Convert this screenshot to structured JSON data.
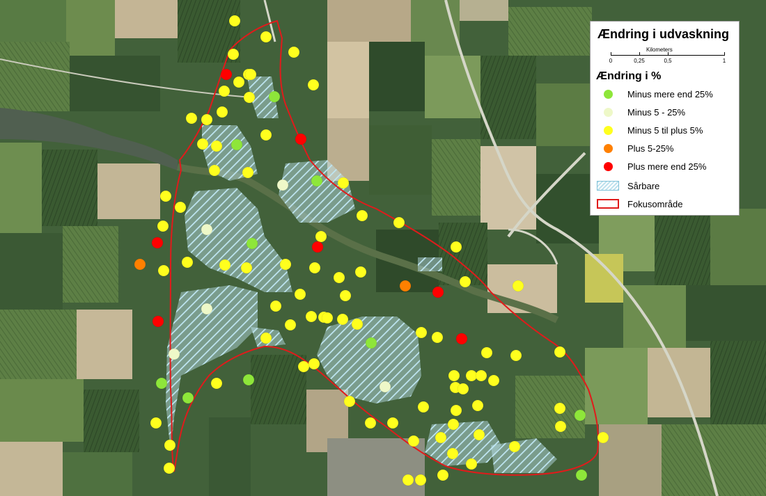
{
  "legend": {
    "title": "Ændring i udvaskning",
    "scale": {
      "caption": "Kilometers",
      "ticks": [
        "0",
        "0,25",
        "0,5",
        "1"
      ]
    },
    "subtitle": "Ændring i %",
    "items": [
      {
        "label": "Minus mere end 25%",
        "color": "#8ee63a",
        "kind": "dot"
      },
      {
        "label": "Minus 5 - 25%",
        "color": "#eef8c8",
        "kind": "dot"
      },
      {
        "label": "Minus 5 til plus 5%",
        "color": "#ffff1e",
        "kind": "dot"
      },
      {
        "label": "Plus 5-25%",
        "color": "#ff8000",
        "kind": "dot"
      },
      {
        "label": "Plus mere end 25%",
        "color": "#ff0000",
        "kind": "dot"
      },
      {
        "label": "Sårbare",
        "color": "#bfe2ee",
        "kind": "hatch"
      },
      {
        "label": "Fokusområde",
        "color": "#e01b1b",
        "kind": "outline"
      }
    ]
  },
  "map": {
    "colors": {
      "field_dark": "#2f4a2a",
      "field_mid": "#486c3a",
      "field_light": "#7d9a5c",
      "field_bare": "#c7b99a",
      "water": "#4e5d4e",
      "road": "#d8d8cc",
      "boundary": "#e01b1b"
    }
  }
}
